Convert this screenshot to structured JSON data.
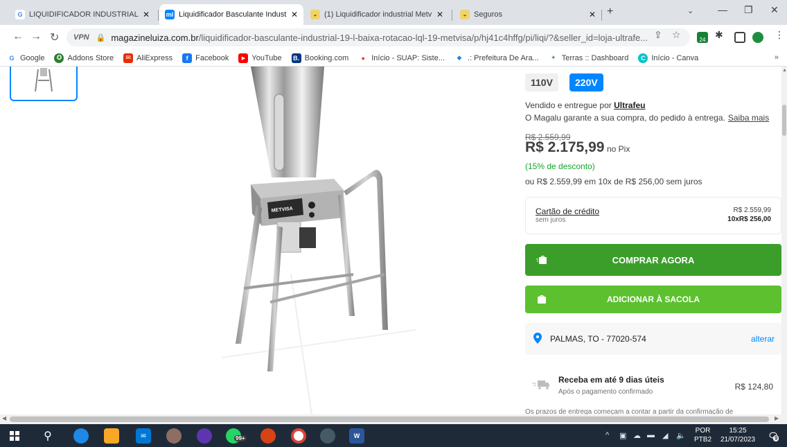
{
  "browser": {
    "tabs": [
      {
        "label": "LIQUIDIFICADOR INDUSTRIAL M",
        "active": false
      },
      {
        "label": "Liquidificador Basculante Industri",
        "active": true
      },
      {
        "label": "(1) Liquidificador industrial Metv",
        "active": false
      },
      {
        "label": "Seguros",
        "active": false
      }
    ],
    "close_glyph": "✕",
    "new_tab_glyph": "+",
    "url_domain": "magazineluiza.com.br",
    "url_path": "/liquidificador-basculante-industrial-19-l-baixa-rotacao-lql-19-metvisa/p/hj41c4hffg/pi/liqi/?&seller_id=loja-ultrafe...",
    "vpn_label": "VPN",
    "extension_badge": "24"
  },
  "bookmarks": [
    {
      "label": "Google",
      "color": "#ffffff",
      "glyph": "G"
    },
    {
      "label": "Addons Store",
      "color": "#2e7d32",
      "glyph": "✪"
    },
    {
      "label": "AliExpress",
      "color": "#e62e04",
      "glyph": "✉"
    },
    {
      "label": "Facebook",
      "color": "#1877f2",
      "glyph": "f"
    },
    {
      "label": "YouTube",
      "color": "#ff0000",
      "glyph": "▶"
    },
    {
      "label": "Booking.com",
      "color": "#003580",
      "glyph": "B."
    },
    {
      "label": "Início - SUAP: Siste...",
      "color": "#e53935",
      "glyph": "●"
    },
    {
      "label": ".: Prefeitura De Ara...",
      "color": "#1e88e5",
      "glyph": "◆"
    },
    {
      "label": "Terras :: Dashboard",
      "color": "#43a047",
      "glyph": "✦"
    },
    {
      "label": "Início - Canva",
      "color": "#00c4cc",
      "glyph": "C"
    }
  ],
  "bookmarks_more": "»",
  "product": {
    "voltage_options": [
      "110V",
      "220V"
    ],
    "selected_voltage": "220V",
    "seller_prefix": "Vendido e entregue por",
    "seller_name": "Ultrafeu",
    "guarantee": "O Magalu garante a sua compra, do pedido à entrega.",
    "guarantee_link": "Saiba mais",
    "old_price": "R$ 2.559,99",
    "price": "R$ 2.175,99",
    "price_suffix": "no Pix",
    "discount": "(15% de desconto)",
    "installments": "ou R$ 2.559,99 em 10x de R$ 256,00 sem juros",
    "card_title": "Cartão de crédito",
    "card_sub": "sem juros",
    "card_price": "R$ 2.559,99",
    "card_installments": "10xR$ 256,00",
    "brand_on_image": "METVISA"
  },
  "actions": {
    "buy_label": "COMPRAR AGORA",
    "bag_label": "ADICIONAR À SACOLA"
  },
  "location": {
    "text": "PALMAS, TO - 77020-574",
    "change": "alterar"
  },
  "delivery": {
    "title": "Receba em até 9 dias úteis",
    "subtitle": "Após o pagamento confirmado",
    "price": "R$ 124,80",
    "note": "Os prazos de entrega começam a contar a partir da confirmação de"
  },
  "taskbar": {
    "lang_top": "POR",
    "lang_bottom": "PTB2",
    "time": "15:25",
    "date": "21/07/2023",
    "whatsapp_badge": "99+",
    "notification_count": "9"
  }
}
